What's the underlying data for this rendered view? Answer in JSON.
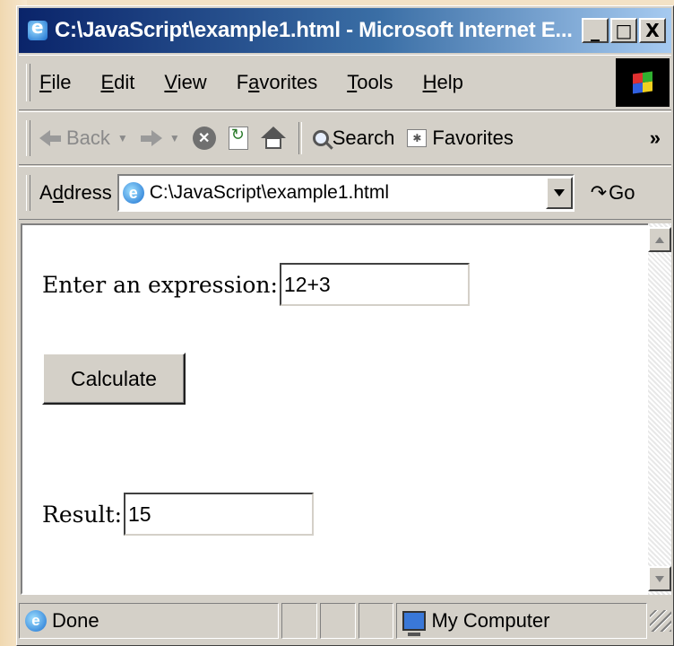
{
  "window": {
    "title": "C:\\JavaScript\\example1.html - Microsoft Internet E...",
    "minimize": "_",
    "maximize": "□",
    "close": "X"
  },
  "menu": {
    "file": {
      "acc": "F",
      "rest": "ile"
    },
    "edit": {
      "acc": "E",
      "rest": "dit"
    },
    "view": {
      "acc": "V",
      "rest": "iew"
    },
    "favorites": {
      "pre": "F",
      "acc": "a",
      "rest": "vorites"
    },
    "tools": {
      "acc": "T",
      "rest": "ools"
    },
    "help": {
      "acc": "H",
      "rest": "elp"
    }
  },
  "toolbar": {
    "back_label": "Back",
    "stop_glyph": "✕",
    "search_label": "Search",
    "favorites_label": "Favorites",
    "more_glyph": "»"
  },
  "address": {
    "label_pre": "A",
    "label_acc": "d",
    "label_rest": "dress",
    "value": "C:\\JavaScript\\example1.html",
    "go_label": "Go"
  },
  "page": {
    "expression_label": "Enter an expression:",
    "expression_value": "12+3",
    "calculate_label": "Calculate",
    "result_label": "Result:",
    "result_value": "15"
  },
  "status": {
    "text": "Done",
    "zone": "My Computer"
  },
  "icons": {
    "app": "ie-page-icon",
    "throbber": "windows-flag-icon",
    "back": "back-arrow-icon",
    "forward": "forward-arrow-icon",
    "stop": "stop-icon",
    "refresh": "refresh-icon",
    "home": "home-icon",
    "search": "search-icon",
    "favorites": "favorites-icon",
    "go": "go-arrow-icon",
    "zone": "my-computer-icon"
  },
  "colors": {
    "titlebar_start": "#0a246a",
    "titlebar_end": "#a6caf0",
    "chrome": "#d4d0c8",
    "slide_background": "#f3e2c6"
  }
}
